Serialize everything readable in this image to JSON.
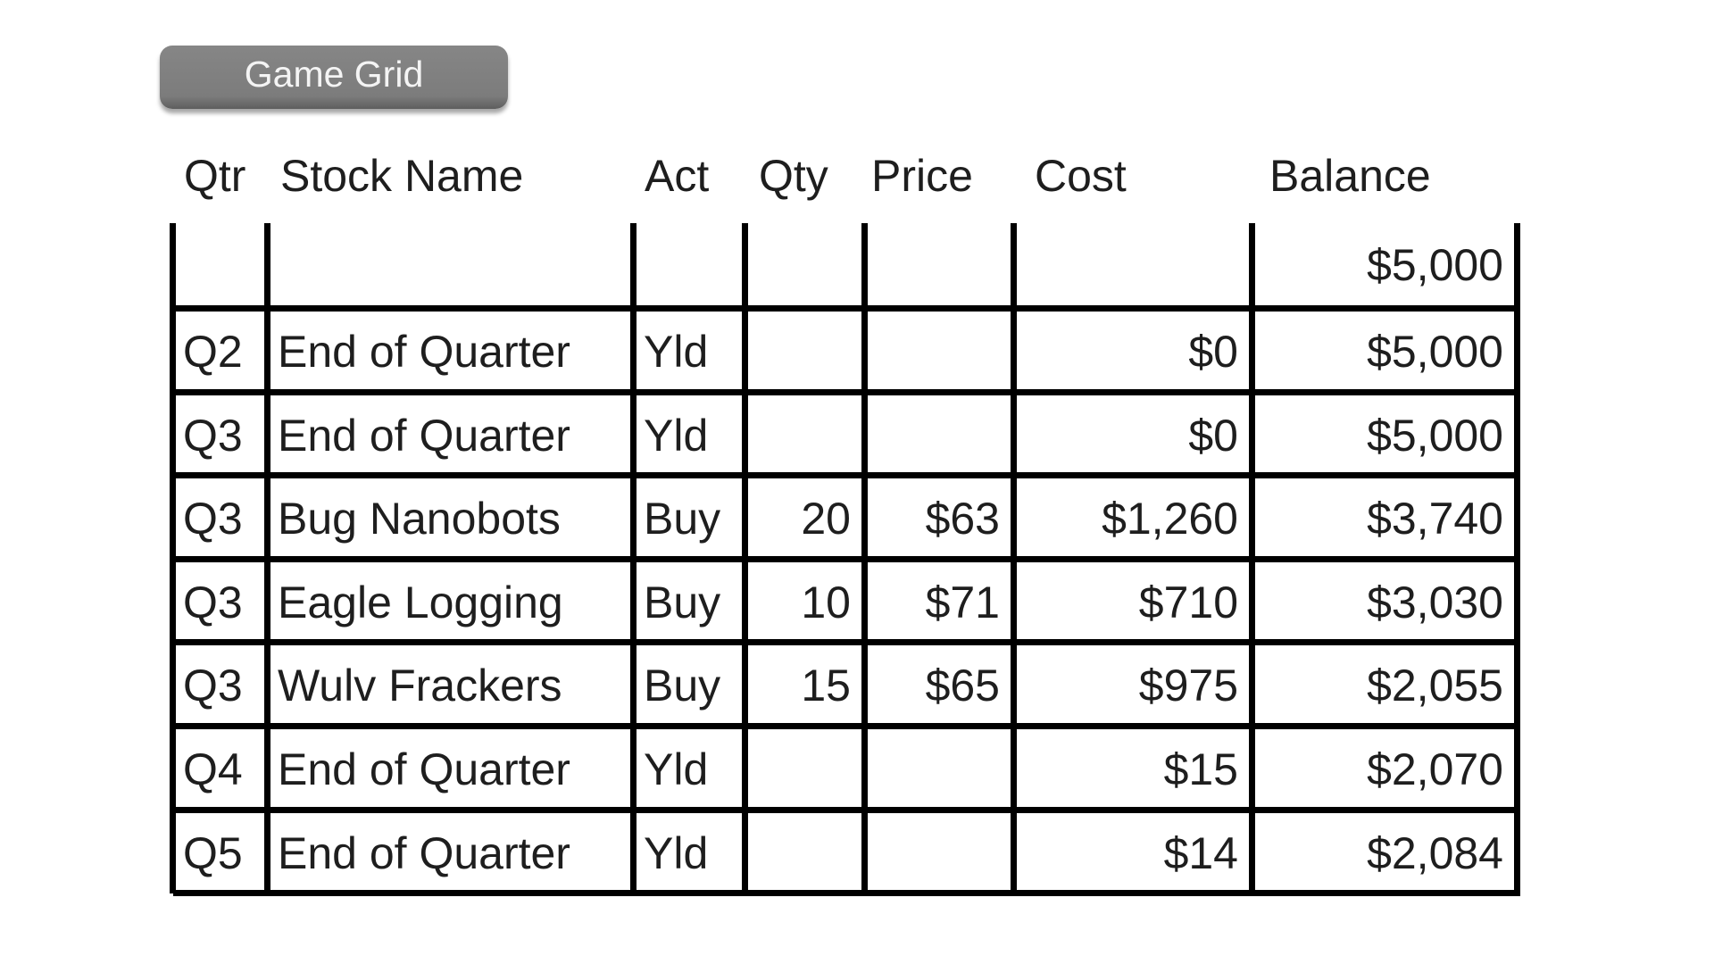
{
  "title_button": {
    "label": "Game Grid"
  },
  "table": {
    "headers": [
      "Qtr",
      "Stock Name",
      "Act",
      "Qty",
      "Price",
      "Cost",
      "Balance"
    ],
    "rows": [
      {
        "qtr": "",
        "stock": "",
        "act": "",
        "qty": "",
        "price": "",
        "cost": "",
        "balance": "$5,000"
      },
      {
        "qtr": "Q2",
        "stock": "End of Quarter",
        "act": "Yld",
        "qty": "",
        "price": "",
        "cost": "$0",
        "balance": "$5,000"
      },
      {
        "qtr": "Q3",
        "stock": "End of Quarter",
        "act": "Yld",
        "qty": "",
        "price": "",
        "cost": "$0",
        "balance": "$5,000"
      },
      {
        "qtr": "Q3",
        "stock": "Bug Nanobots",
        "act": "Buy",
        "qty": "20",
        "price": "$63",
        "cost": "$1,260",
        "balance": "$3,740"
      },
      {
        "qtr": "Q3",
        "stock": "Eagle Logging",
        "act": "Buy",
        "qty": "10",
        "price": "$71",
        "cost": "$710",
        "balance": "$3,030"
      },
      {
        "qtr": "Q3",
        "stock": "Wulv Frackers",
        "act": "Buy",
        "qty": "15",
        "price": "$65",
        "cost": "$975",
        "balance": "$2,055"
      },
      {
        "qtr": "Q4",
        "stock": "End of Quarter",
        "act": "Yld",
        "qty": "",
        "price": "",
        "cost": "$15",
        "balance": "$2,070"
      },
      {
        "qtr": "Q5",
        "stock": "End of Quarter",
        "act": "Yld",
        "qty": "",
        "price": "",
        "cost": "$14",
        "balance": "$2,084"
      }
    ]
  },
  "colors": {
    "button_bg": "#7f7f7f",
    "button_text": "#f4f4f4",
    "grid_line": "#000000",
    "text": "#1e1e1e"
  }
}
